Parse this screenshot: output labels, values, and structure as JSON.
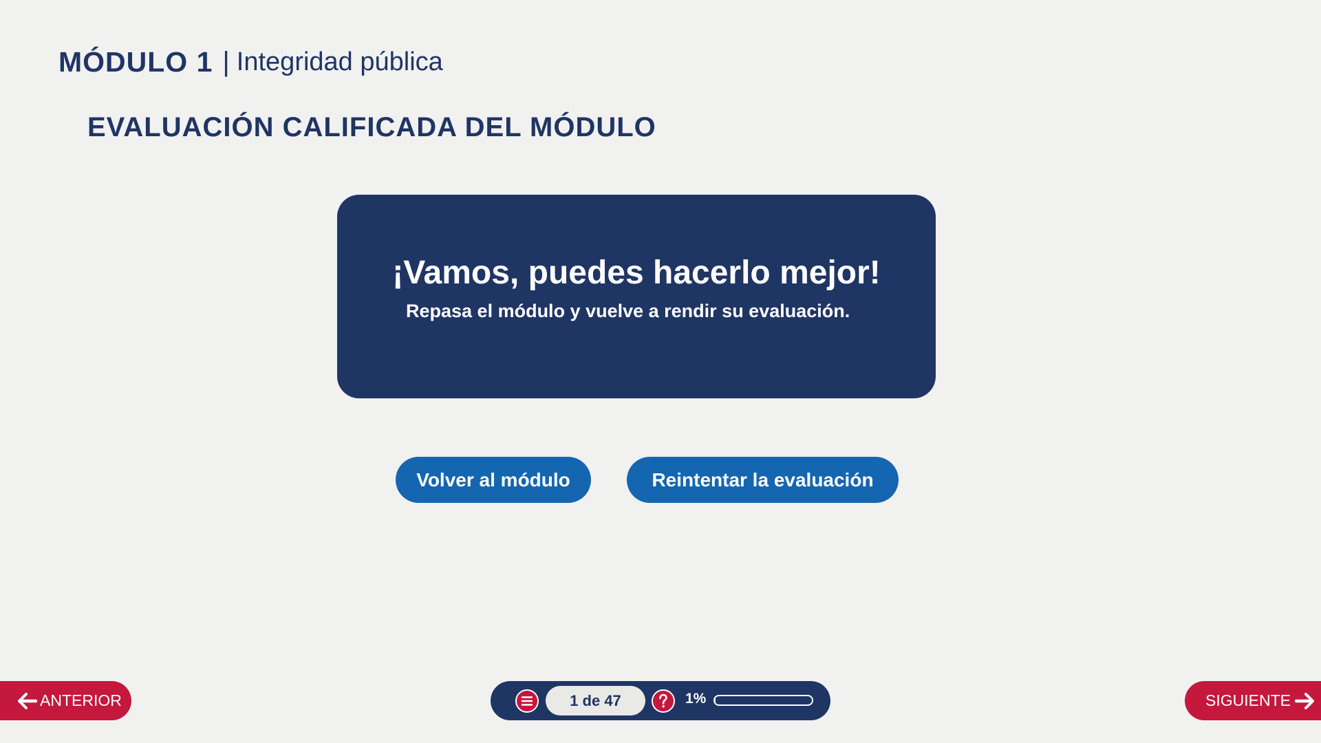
{
  "header": {
    "module_label": "MÓDULO 1",
    "separator": "|",
    "module_subtitle": "Integridad pública",
    "section_title": "EVALUACIÓN CALIFICADA DEL MÓDULO"
  },
  "feedback": {
    "title": "¡Vamos, puedes hacerlo mejor!",
    "subtitle": "Repasa el módulo y vuelve a rendir su evaluación."
  },
  "actions": {
    "back_to_module": "Volver al módulo",
    "retry_evaluation": "Reintentar la evaluación"
  },
  "navigation": {
    "previous_label": "ANTERIOR",
    "next_label": "SIGUIENTE",
    "previous_icon": "arrow-left-icon",
    "next_icon": "arrow-right-icon"
  },
  "toolbar": {
    "menu_icon": "menu-icon",
    "help_icon": "help-icon",
    "page_indicator": "1 de 47",
    "progress_label": "1%",
    "progress_value": 0.01
  },
  "colors": {
    "navy": "#1f3564",
    "button_blue": "#1566b0",
    "nav_red": "#c4183c",
    "background": "#f1f1f0"
  }
}
